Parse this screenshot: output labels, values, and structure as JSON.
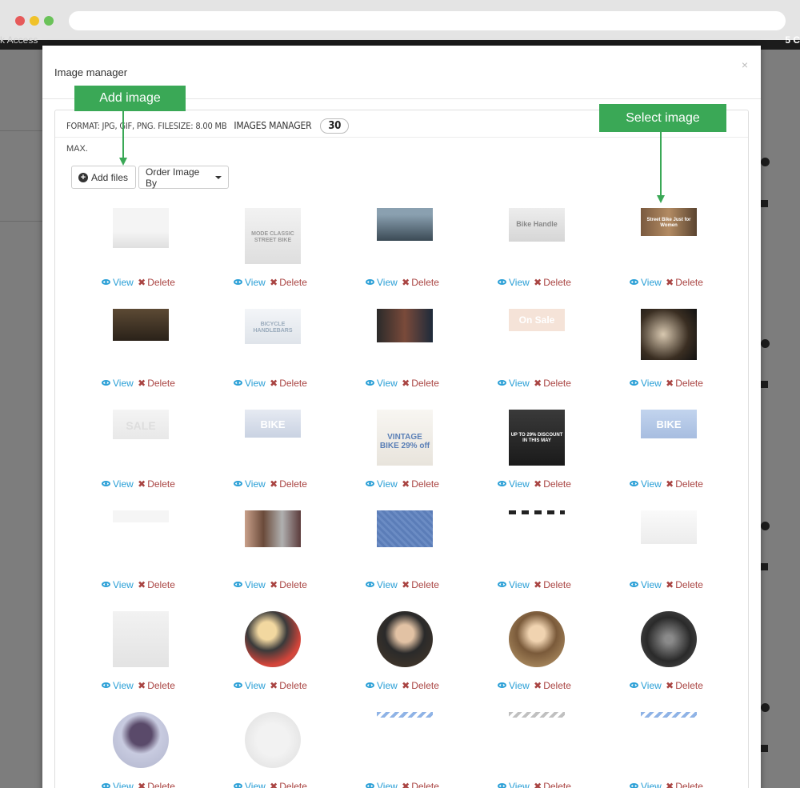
{
  "background_page": {
    "left_text": "k Access",
    "right_text": "5 C"
  },
  "modal": {
    "title": "Image manager",
    "close_label": "×",
    "format_info": "FORMAT: JPG, GIF, PNG. FILESIZE: 8.00 MB",
    "max_label": "MAX.",
    "manager_label": "IMAGES MANAGER",
    "image_count": "30",
    "add_files_label": "Add files",
    "order_by_label": "Order Image By"
  },
  "actions": {
    "view_label": "View",
    "delete_label": "Delete"
  },
  "callouts": {
    "add_image": "Add image",
    "select_image": "Select image"
  },
  "colors": {
    "accent_green": "#3aa856",
    "view_blue": "#2a9fd6",
    "delete_red": "#a94442"
  },
  "thumbnails": [
    {
      "text": ""
    },
    {
      "text": "MODE CLASSIC STREET BIKE"
    },
    {
      "text": ""
    },
    {
      "text": "Bike Handle"
    },
    {
      "text": "Street Bike Just for Women"
    },
    {
      "text": ""
    },
    {
      "text": "BICYCLE HANDLEBARS"
    },
    {
      "text": ""
    },
    {
      "text": "On Sale"
    },
    {
      "text": ""
    },
    {
      "text": "SALE"
    },
    {
      "text": "BIKE"
    },
    {
      "text": "VINTAGE BIKE 29% off"
    },
    {
      "text": "UP TO 29% DISCOUNT IN THIS MAY"
    },
    {
      "text": "BIKE"
    },
    {
      "text": ""
    },
    {
      "text": ""
    },
    {
      "text": ""
    },
    {
      "text": ""
    },
    {
      "text": ""
    },
    {
      "text": ""
    },
    {
      "text": ""
    },
    {
      "text": ""
    },
    {
      "text": ""
    },
    {
      "text": ""
    },
    {
      "text": ""
    },
    {
      "text": ""
    },
    {
      "text": ""
    },
    {
      "text": ""
    },
    {
      "text": ""
    }
  ]
}
